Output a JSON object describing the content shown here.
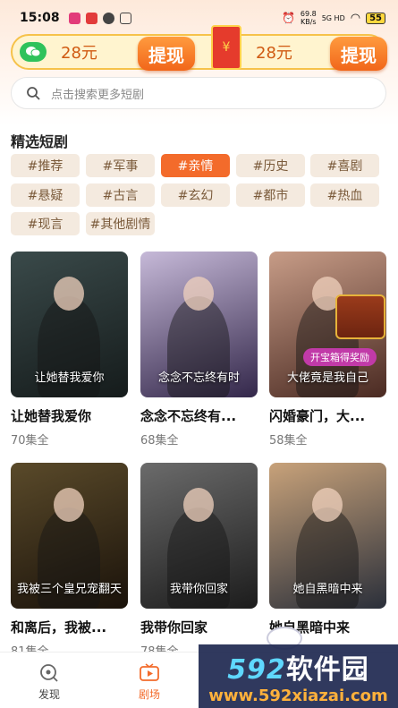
{
  "status_bar": {
    "time": "15:08",
    "net_speed": "69.8",
    "net_unit": "KB/s",
    "signal": "5G HD",
    "battery": "55"
  },
  "reward": {
    "left_amount": "28元",
    "right_amount": "28元",
    "withdraw_label": "提现",
    "yuan_symbol": "¥"
  },
  "search": {
    "placeholder": "点击搜索更多短剧"
  },
  "section": {
    "title": "精选短剧"
  },
  "tags": [
    {
      "label": "#推荐",
      "active": false
    },
    {
      "label": "#军事",
      "active": false
    },
    {
      "label": "#亲情",
      "active": true
    },
    {
      "label": "#历史",
      "active": false
    },
    {
      "label": "#喜剧",
      "active": false
    },
    {
      "label": "#悬疑",
      "active": false
    },
    {
      "label": "#古言",
      "active": false
    },
    {
      "label": "#玄幻",
      "active": false
    },
    {
      "label": "#都市",
      "active": false
    },
    {
      "label": "#热血",
      "active": false
    },
    {
      "label": "#现言",
      "active": false
    },
    {
      "label": "#其他剧情",
      "active": false
    }
  ],
  "cards": [
    {
      "title": "让她替我爱你",
      "episodes": "70集全",
      "poster_text": "让她替我爱你",
      "colors": [
        "#3a4a4a",
        "#151b1b"
      ]
    },
    {
      "title": "念念不忘终有...",
      "episodes": "68集全",
      "poster_text": "念念不忘终有时",
      "colors": [
        "#c6b9d8",
        "#33274a"
      ]
    },
    {
      "title": "闪婚豪门，大...",
      "episodes": "58集全",
      "poster_text": "大佬竟是我自己",
      "colors": [
        "#c79c87",
        "#4a2a22"
      ],
      "badge": "开宝箱得奖励"
    },
    {
      "title": "和离后，我被...",
      "episodes": "81集全",
      "poster_text": "我被三个皇兄宠翻天",
      "colors": [
        "#5a4a2a",
        "#1a120a"
      ]
    },
    {
      "title": "我带你回家",
      "episodes": "78集全",
      "poster_text": "我带你回家",
      "colors": [
        "#6b6b6b",
        "#1c1c1c"
      ]
    },
    {
      "title": "她自黑暗中来",
      "episodes": "",
      "poster_text": "她自黑暗中来",
      "colors": [
        "#c8a27a",
        "#2a2f3a"
      ]
    }
  ],
  "tabbar": {
    "tabs": [
      {
        "label": "发现",
        "icon": "discover-icon",
        "active": false
      },
      {
        "label": "剧场",
        "icon": "theater-icon",
        "active": true
      }
    ]
  },
  "watermark": {
    "brand": "592软件园",
    "brand_num": "592",
    "brand_text": "软件园",
    "url": "www.592xiazai.com"
  },
  "colors": {
    "accent": "#f36b2b",
    "tag_bg": "#f4eadf",
    "reward_border": "#f6c24a"
  }
}
